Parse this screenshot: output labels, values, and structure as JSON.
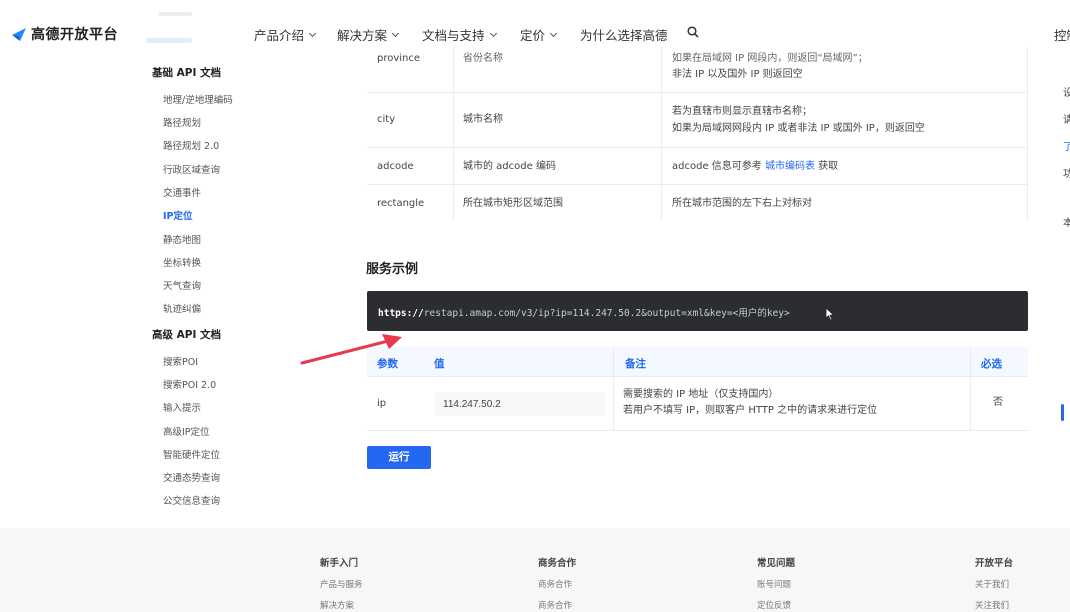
{
  "topnav": {
    "logo_text": "高德开放平台",
    "items": [
      "产品介绍",
      "解决方案",
      "文档与支持",
      "定价",
      "为什么选择高德"
    ],
    "right_label": "控制"
  },
  "sidebar": {
    "group1": "基础 API 文档",
    "group1_items": [
      "地理/逆地理编码",
      "路径规划",
      "路径规划 2.0",
      "行政区域查询",
      "交通事件",
      "IP定位",
      "静态地图",
      "坐标转换",
      "天气查询",
      "轨迹纠偏"
    ],
    "active_item": "IP定位",
    "group2": "高级 API 文档",
    "group2_items": [
      "搜索POI",
      "搜索POI 2.0",
      "输入提示",
      "高级IP定位",
      "智能硬件定位",
      "交通态势查询",
      "公交信息查询"
    ]
  },
  "response_table": {
    "rows": [
      {
        "name": "province",
        "meaning": "省份名称",
        "note_lines": [
          "如果在局域网 IP 网段内，则返回“局域网”；",
          "非法 IP 以及国外 IP 则返回空"
        ]
      },
      {
        "name": "city",
        "meaning": "城市名称",
        "note_lines": [
          "若为直辖市则显示直辖市名称；",
          "如果为局域网网段内 IP 或者非法 IP 或国外 IP，则返回空"
        ]
      },
      {
        "name": "adcode",
        "meaning": "城市的 adcode 编码",
        "note_prefix": "adcode 信息可参考 ",
        "note_link": "城市编码表",
        "note_suffix": " 获取"
      },
      {
        "name": "rectangle",
        "meaning": "所在城市矩形区域范围",
        "note_lines": [
          "所在城市范围的左下右上对标对"
        ]
      }
    ]
  },
  "example": {
    "title": "服务示例",
    "url_prefix": "https://",
    "url_rest": "restapi.amap.com/v3/ip?ip=114.247.50.2&output=xml&key=<用户的key>"
  },
  "param_table": {
    "headers": [
      "参数",
      "值",
      "备注",
      "必选"
    ],
    "row": {
      "name": "ip",
      "value": "114.247.50.2",
      "note_lines": [
        "需要搜索的 IP 地址（仅支持国内）",
        "若用户不填写 IP，则取客户 HTTP 之中的请求来进行定位"
      ],
      "required": "否"
    }
  },
  "run_button": "运行",
  "right_col": [
    "设",
    "请",
    "了",
    "功"
  ],
  "right_col_2": "本",
  "footer": {
    "columns": [
      {
        "title": "新手入门",
        "links": [
          "产品与服务",
          "解决方案"
        ]
      },
      {
        "title": "商务合作",
        "links": [
          "商务合作",
          "商务合作"
        ]
      },
      {
        "title": "常见问题",
        "links": [
          "账号问题",
          "定位反馈"
        ]
      },
      {
        "title": "开放平台",
        "links": [
          "关于我们",
          "关注我们"
        ]
      }
    ]
  },
  "colors": {
    "accent": "#2468f2",
    "code_bg": "#2b2d31",
    "arrow": "#e8384f"
  }
}
